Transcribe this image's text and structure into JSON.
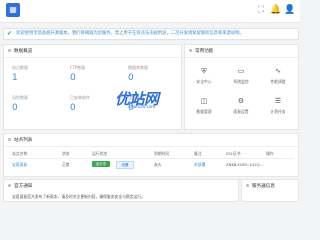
{
  "colors": {
    "accent": "#2f6fde",
    "success": "#3aa757",
    "link": "#3a8fd8"
  },
  "topbar": {
    "logo_icon": "grid-logo-icon",
    "right_icons": [
      "fullscreen-icon",
      "bell-icon",
      "user-icon"
    ]
  },
  "notice": {
    "icon": "check-circle-icon",
    "text": "欢迎使用宝塔面板开源版本，我们将竭诚为您服务，禁止用于任何违法违规用途，二次开发请保留版权信息和来源说明。"
  },
  "data_overview": {
    "title": "数据概览",
    "stats": [
      {
        "label": "站点数量",
        "value": "1"
      },
      {
        "label": "FTP数量",
        "value": "0"
      },
      {
        "label": "数据库数量",
        "value": "0"
      },
      {
        "label": "风险数量",
        "value": "0"
      },
      {
        "label": "已安装软件",
        "value": "0"
      },
      {
        "label": "告警数量",
        "value": "0"
      }
    ]
  },
  "quick_entry": {
    "title": "常用功能",
    "items": [
      {
        "icon": "shield-icon",
        "label": "安全中心"
      },
      {
        "icon": "monitor-icon",
        "label": "系统监控"
      },
      {
        "icon": "pulse-icon",
        "label": "性能调整"
      },
      {
        "icon": "database-icon",
        "label": "数据管理"
      },
      {
        "icon": "settings-icon",
        "label": "面板设置"
      },
      {
        "icon": "sliders-icon",
        "label": "计划任务"
      }
    ]
  },
  "watermark": {
    "logo": "优站网",
    "sub": "shancco.com"
  },
  "site_table": {
    "title": "站点列表",
    "headers": [
      "站点名称",
      "状态",
      "运行状态",
      "到期时间",
      "备注",
      "SSL证书",
      "操作"
    ],
    "rows": [
      {
        "name": "宝塔面板",
        "status": "正常",
        "run_status": "运行中",
        "action_label": "设置",
        "expire": "永久",
        "ssl": "未部署",
        "remark": "ZNKB-YUK5-1Q2Q..."
      }
    ]
  },
  "news": {
    "title": "官方通知",
    "text": "宝塔面板官方发布了新版本，请及时关注更新内容，确保服务安全与稳定运行。"
  },
  "server_panel": {
    "title": "服务器信息"
  }
}
